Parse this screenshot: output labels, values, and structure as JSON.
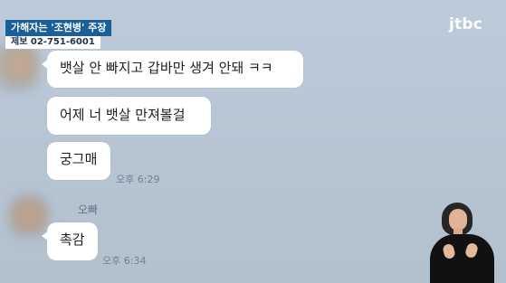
{
  "news": {
    "label": "가해자는 '조현병' 주장",
    "tip_line": "제보 02-751-6001",
    "logo": "jtbc"
  },
  "chat": {
    "messages": [
      {
        "text": "뱃살 안 빠지고 갑바만 생겨 안돼 ㅋㅋ"
      },
      {
        "text": "어제 너 뱃살 만져볼걸"
      },
      {
        "text": "궁그매",
        "time": "오후 6:29"
      },
      {
        "sender": "오빠",
        "text": "촉감",
        "time": "오후 6:34"
      }
    ]
  }
}
